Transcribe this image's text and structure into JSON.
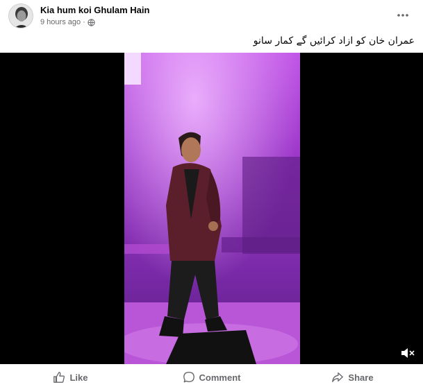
{
  "post": {
    "author": "Kia hum koi Ghulam Hain",
    "time": "9 hours ago",
    "separator": "·",
    "caption": "عمران خان کو ازاد کرائیں گے کمار سانو"
  },
  "icons": {
    "privacy": "globe-icon",
    "menu": "more-options-icon",
    "volume": "speaker-muted-icon",
    "like": "thumbs-up-icon",
    "comment": "speech-bubble-icon",
    "share": "share-arrow-icon"
  },
  "actions": {
    "like": "Like",
    "comment": "Comment",
    "share": "Share"
  },
  "colors": {
    "text_primary": "#050505",
    "text_secondary": "#65676b",
    "video_background": "#000000",
    "stage_light": "#b040e0"
  }
}
